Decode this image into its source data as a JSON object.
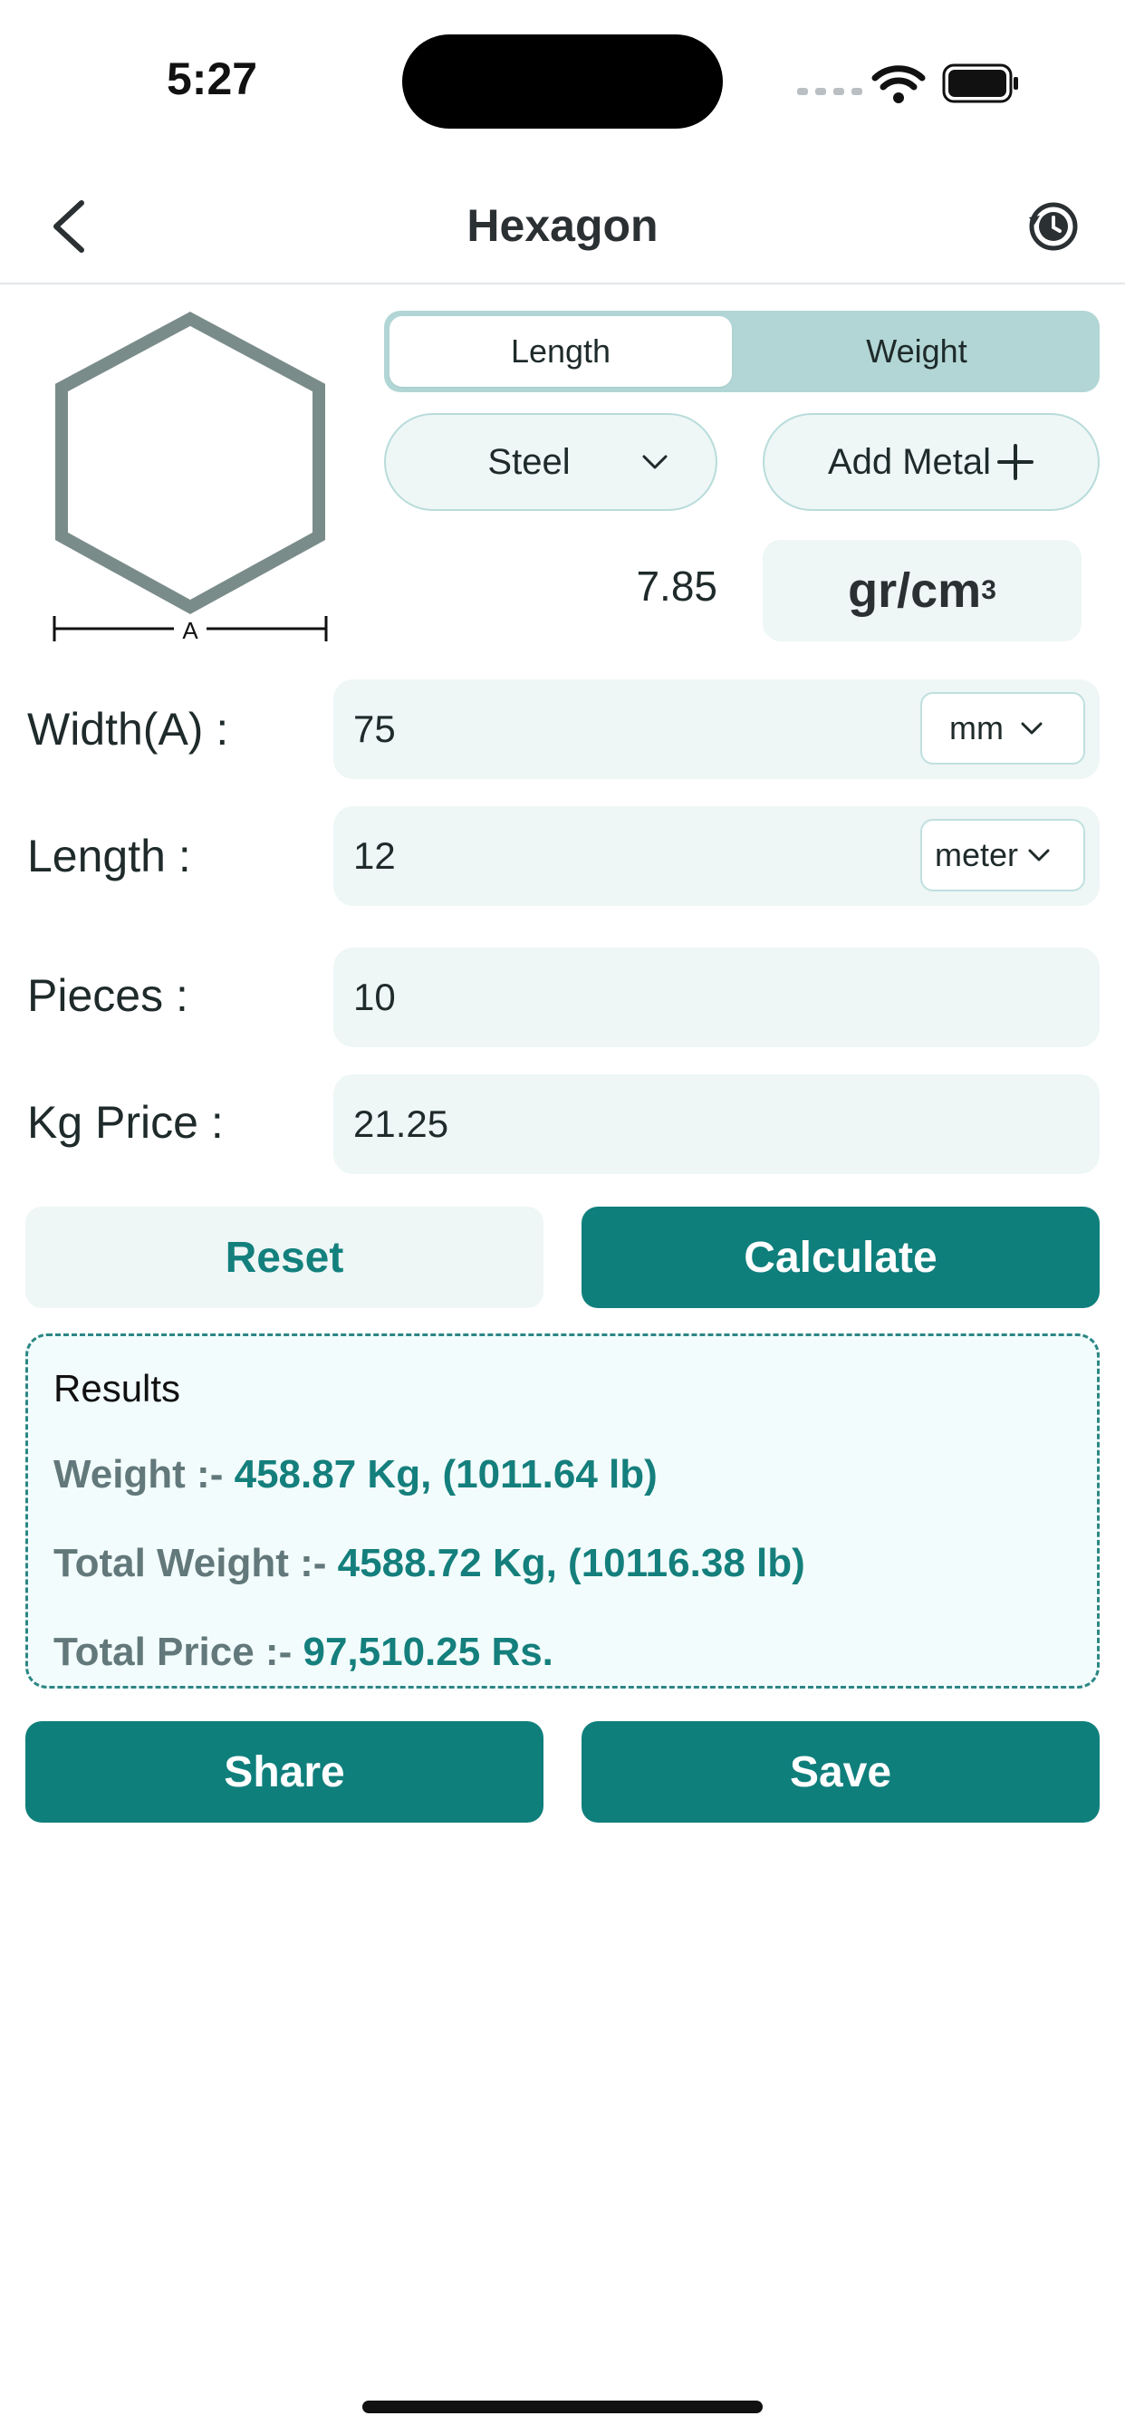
{
  "status_bar": {
    "time": "5:27"
  },
  "header": {
    "title": "Hexagon"
  },
  "diagram": {
    "dimension_label": "A"
  },
  "mode_toggle": {
    "options": [
      "Length",
      "Weight"
    ],
    "selected": "Length"
  },
  "material": {
    "selected": "Steel",
    "add_label": "Add Metal",
    "density_value": "7.85",
    "density_unit": "gr/cm",
    "density_unit_sup": "3"
  },
  "form": {
    "width": {
      "label": "Width(A) :",
      "value": "75",
      "unit": "mm"
    },
    "length": {
      "label": "Length :",
      "value": "12",
      "unit": "meter"
    },
    "pieces": {
      "label": "Pieces :",
      "value": "10"
    },
    "kg_price": {
      "label": "Kg Price :",
      "value": "21.25"
    }
  },
  "actions": {
    "reset": "Reset",
    "calculate": "Calculate",
    "share": "Share",
    "save": "Save"
  },
  "results": {
    "title": "Results",
    "weight_label": "Weight :-",
    "weight_value": "458.87 Kg, (1011.64 lb)",
    "total_weight_label": "Total Weight :-",
    "total_weight_value": "4588.72 Kg, (10116.38 lb)",
    "total_price_label": "Total Price :-",
    "total_price_value": "97,510.25 Rs."
  },
  "colors": {
    "accent": "#0f7f7c",
    "field_bg": "#eef6f6",
    "segment_bg": "#b1d6d5",
    "shape_stroke": "#7a8c8a"
  }
}
